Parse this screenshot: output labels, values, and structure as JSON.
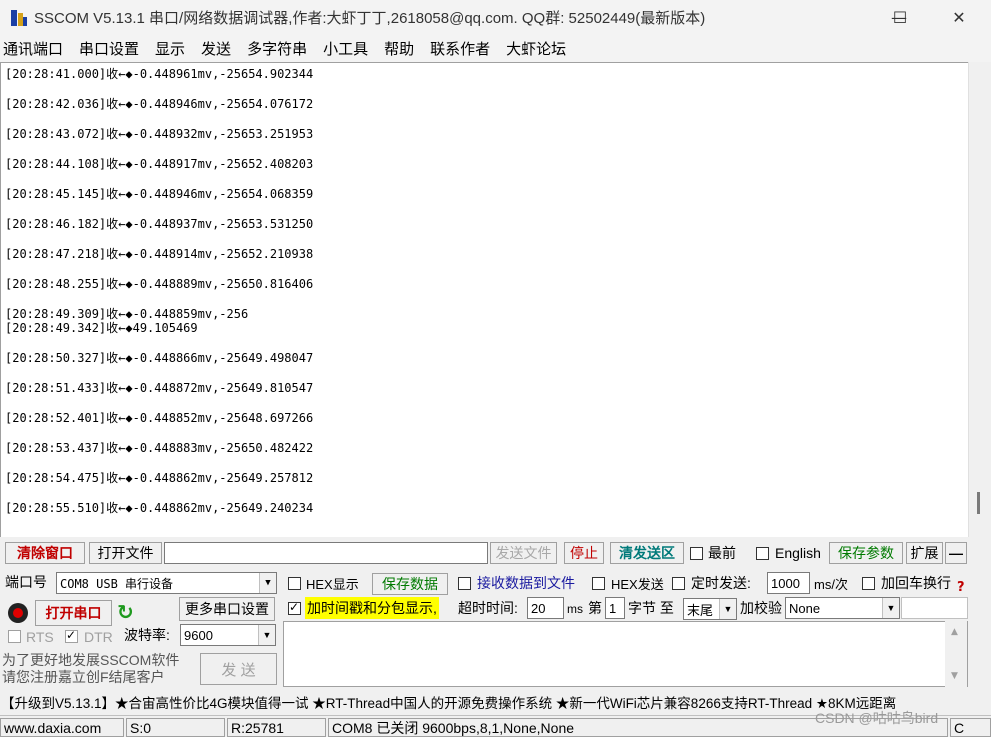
{
  "window": {
    "title": "SSCOM V5.13.1 串口/网络数据调试器,作者:大虾丁丁,2618058@qq.com. QQ群: 52502449(最新版本)",
    "minimize": "—",
    "maximize": "☐",
    "close": "✕"
  },
  "menu": [
    "通讯端口",
    "串口设置",
    "显示",
    "发送",
    "多字符串",
    "小工具",
    "帮助",
    "联系作者",
    "大虾论坛"
  ],
  "receive": {
    "lines": [
      "[20:28:41.000]收←◆-0.448961mv,-25654.902344",
      "[20:28:42.036]收←◆-0.448946mv,-25654.076172",
      "[20:28:43.072]收←◆-0.448932mv,-25653.251953",
      "[20:28:44.108]收←◆-0.448917mv,-25652.408203",
      "[20:28:45.145]收←◆-0.448946mv,-25654.068359",
      "[20:28:46.182]收←◆-0.448937mv,-25653.531250",
      "[20:28:47.218]收←◆-0.448914mv,-25652.210938",
      "[20:28:48.255]收←◆-0.448889mv,-25650.816406",
      "[20:28:49.309]收←◆-0.448859mv,-256",
      "[20:28:49.342]收←◆49.105469",
      "[20:28:50.327]收←◆-0.448866mv,-25649.498047",
      "[20:28:51.433]收←◆-0.448872mv,-25649.810547",
      "[20:28:52.401]收←◆-0.448852mv,-25648.697266",
      "[20:28:53.437]收←◆-0.448883mv,-25650.482422",
      "[20:28:54.475]收←◆-0.448862mv,-25649.257812",
      "[20:28:55.510]收←◆-0.448862mv,-25649.240234"
    ]
  },
  "toolbar": {
    "clear_window": "清除窗口",
    "open_file": "打开文件",
    "file_path": "",
    "send_file": "发送文件",
    "stop": "停止",
    "clear_send": "清发送区",
    "top_most": "最前",
    "english": "English",
    "save_params": "保存参数",
    "expand": "扩展",
    "collapse": "—"
  },
  "port": {
    "port_label": "端口号",
    "port_value": "COM8 USB 串行设备",
    "open_port": "打开串口",
    "more_settings": "更多串口设置",
    "rts": "RTS",
    "dtr": "DTR",
    "baud_label": "波特率:",
    "baud_value": "9600",
    "promo_line1": "为了更好地发展SSCOM软件",
    "promo_line2": "请您注册嘉立创F结尾客户",
    "send": "发 送"
  },
  "options": {
    "hex_display": "HEX显示",
    "save_data": "保存数据",
    "recv_to_file": "接收数据到文件",
    "hex_send": "HEX发送",
    "timed_send": "定时发送:",
    "interval": "1000",
    "interval_unit": "ms/次",
    "add_crlf": "加回车换行",
    "timestamp": "加时间戳和分包显示,",
    "timeout_label": "超时时间:",
    "timeout_value": "20",
    "timeout_unit": "ms",
    "nth_label": "第",
    "nth_value": "1",
    "byte_label": "字节 至",
    "end_value": "末尾",
    "checksum_label": "加校验",
    "checksum_value": "None"
  },
  "ticker": "【升级到V5.13.1】★合宙高性价比4G模块值得一试 ★RT-Thread中国人的开源免费操作系统 ★新一代WiFi芯片兼容8266支持RT-Thread ★8KM远距离",
  "status": {
    "site": "www.daxia.com",
    "sent": "S:0",
    "received": "R:25781",
    "port_state": "COM8 已关闭  9600bps,8,1,None,None",
    "watermark": "CSDN @咕咕鸟bird",
    "last": "C"
  },
  "colors": {
    "highlight_yellow": "#ffff00",
    "red_label": "#c00000",
    "green_label": "#007a00"
  }
}
